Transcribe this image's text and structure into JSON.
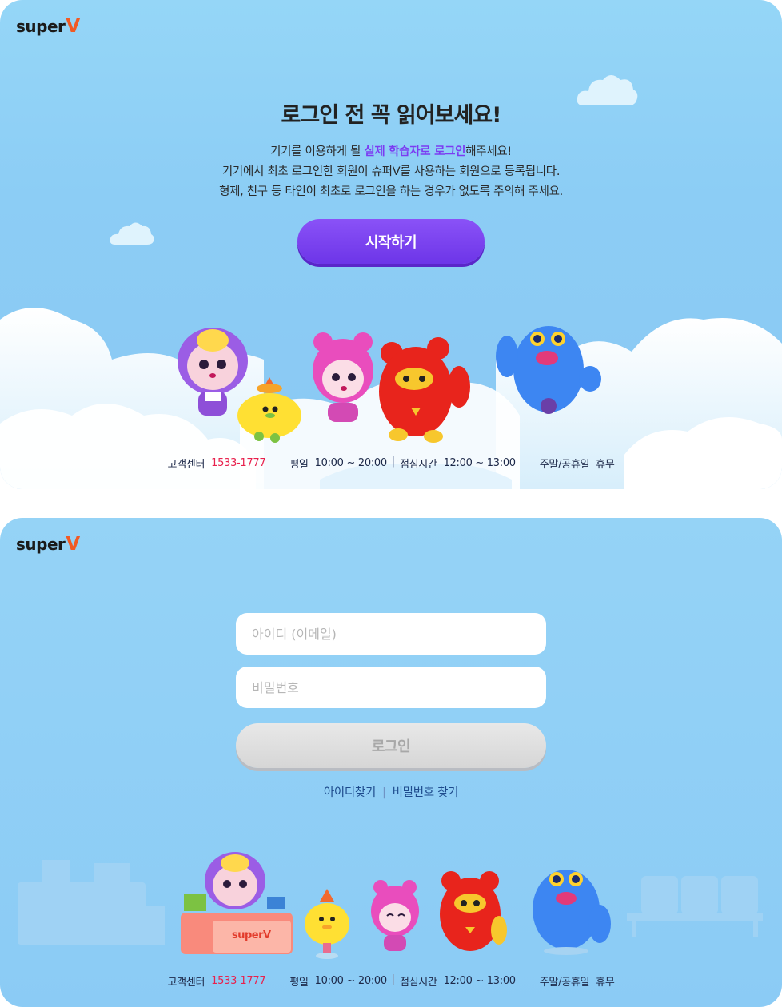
{
  "brand": {
    "logo_text": "super",
    "logo_v": "V"
  },
  "intro": {
    "title": "로그인 전 꼭 읽어보세요!",
    "desc_line1_pre": "기기를 이용하게 될 ",
    "desc_line1_highlight": "실제 학습자로 로그인",
    "desc_line1_post": "해주세요!",
    "desc_line2": "기기에서 최초 로그인한 회원이 슈퍼V를 사용하는 회원으로 등록됩니다.",
    "desc_line3": "형제, 친구 등 타인이 최초로 로그인을 하는 경우가 없도록 주의해 주세요.",
    "start_button": "시작하기"
  },
  "footer": {
    "center_label": "고객센터",
    "phone": "1533-1777",
    "weekday_label": "평일",
    "weekday_hours": "10:00 ~ 20:00",
    "lunch_label": "점심시간",
    "lunch_hours": "12:00 ~ 13:00",
    "holiday_label": "주말/공휴일",
    "holiday_value": "휴무"
  },
  "login": {
    "id_placeholder": "아이디 (이메일)",
    "pw_placeholder": "비밀번호",
    "login_button": "로그인",
    "find_id": "아이디찾기",
    "find_pw": "비밀번호 찾기",
    "desk_logo_text": "super",
    "desk_logo_v": "V"
  },
  "colors": {
    "accent_purple": "#7b3cf2",
    "phone_red": "#e8214d",
    "logo_orange": "#f15a24",
    "sky": "#8ccdf5"
  }
}
